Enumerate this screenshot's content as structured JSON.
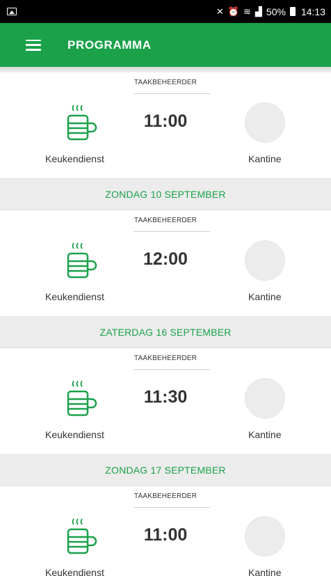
{
  "status_bar": {
    "left_icon": "image-icon",
    "right_icons": [
      "mute-icon",
      "alarm-icon",
      "wifi-icon",
      "signal-icon"
    ],
    "battery": "50%",
    "time": "14:13"
  },
  "app_bar": {
    "menu_icon": "hamburger-menu-icon",
    "title": "PROGRAMMA",
    "color": "#1aa14a"
  },
  "entries": [
    {
      "date": "",
      "role": "TAAKBEHEERDER",
      "time": "11:00",
      "task": "Keukendienst",
      "place": "Kantine"
    },
    {
      "date": "ZONDAG 10 SEPTEMBER",
      "role": "TAAKBEHEERDER",
      "time": "12:00",
      "task": "Keukendienst",
      "place": "Kantine"
    },
    {
      "date": "ZATERDAG 16 SEPTEMBER",
      "role": "TAAKBEHEERDER",
      "time": "11:30",
      "task": "Keukendienst",
      "place": "Kantine"
    },
    {
      "date": "ZONDAG 17 SEPTEMBER",
      "role": "TAAKBEHEERDER",
      "time": "11:00",
      "task": "Keukendienst",
      "place": "Kantine"
    }
  ]
}
